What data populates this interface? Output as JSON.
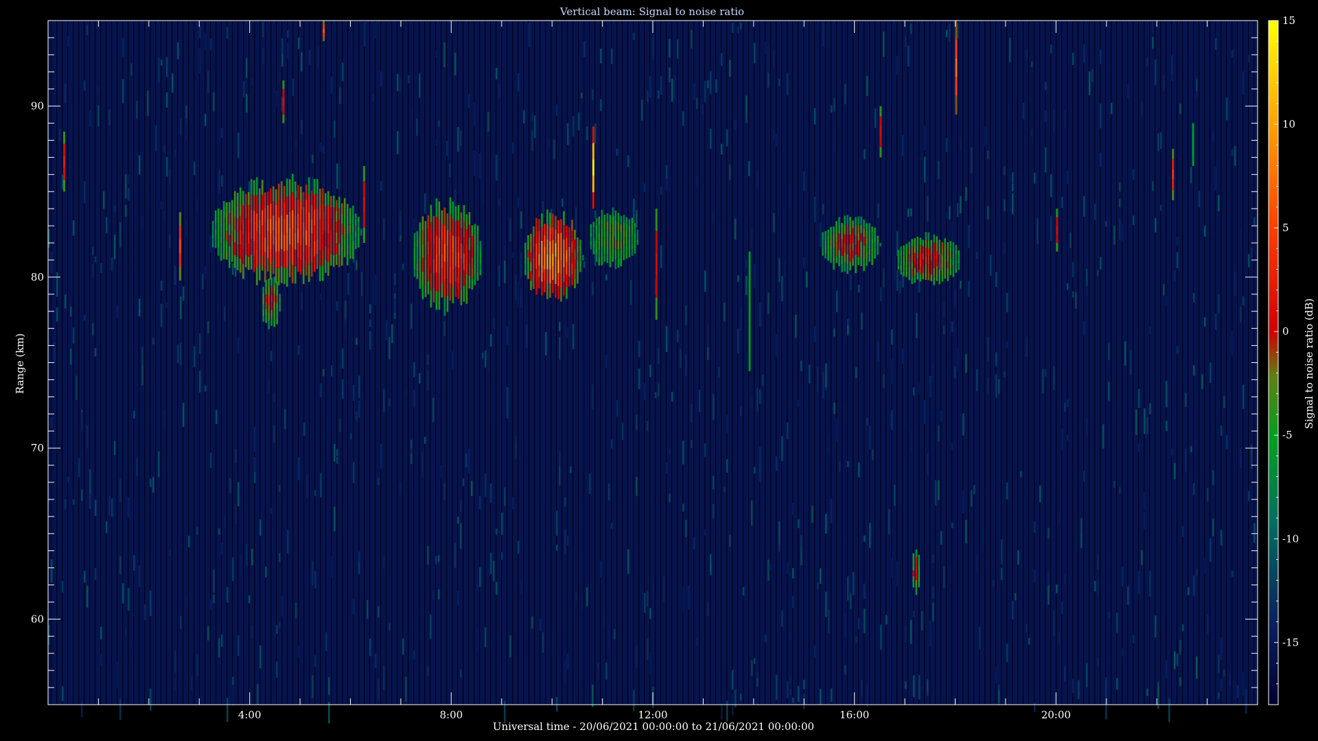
{
  "chart_data": {
    "type": "heatmap",
    "title": "Vertical beam: Signal to noise ratio",
    "xlabel": "Universal time - 20/06/2021 00:00:00 to 21/06/2021 00:00:00",
    "ylabel": "Range (km)",
    "colorbar_label": "Signal to noise ratio (dB)",
    "x_range_hours": [
      0,
      24
    ],
    "y_range_km": [
      55,
      95
    ],
    "x_ticks": [
      {
        "hour": 4,
        "label": "4:00"
      },
      {
        "hour": 8,
        "label": "8:00"
      },
      {
        "hour": 12,
        "label": "12:00"
      },
      {
        "hour": 16,
        "label": "16:00"
      },
      {
        "hour": 20,
        "label": "20:00"
      }
    ],
    "y_ticks": [
      {
        "km": 60,
        "label": "60"
      },
      {
        "km": 70,
        "label": "70"
      },
      {
        "km": 80,
        "label": "80"
      },
      {
        "km": 90,
        "label": "90"
      }
    ],
    "colorbar_range_db": [
      -18,
      15
    ],
    "colorbar_ticks": [
      {
        "db": 15,
        "label": "15"
      },
      {
        "db": 10,
        "label": "10"
      },
      {
        "db": 5,
        "label": "5"
      },
      {
        "db": 0,
        "label": "0"
      },
      {
        "db": -5,
        "label": "-5"
      },
      {
        "db": -10,
        "label": "-10"
      },
      {
        "db": -15,
        "label": "-15"
      }
    ],
    "colormap": [
      {
        "db": -18,
        "color": "#000030"
      },
      {
        "db": -14,
        "color": "#0a2060"
      },
      {
        "db": -9,
        "color": "#007060"
      },
      {
        "db": -5,
        "color": "#00a020"
      },
      {
        "db": -2,
        "color": "#608010"
      },
      {
        "db": 0,
        "color": "#d00000"
      },
      {
        "db": 5,
        "color": "#ff4000"
      },
      {
        "db": 9,
        "color": "#ff9000"
      },
      {
        "db": 15,
        "color": "#ffff00"
      }
    ],
    "echo_regions": [
      {
        "t0": 3.2,
        "t1": 6.2,
        "r0": 79.5,
        "r1": 85.8,
        "peak_db": 6
      },
      {
        "t0": 4.2,
        "t1": 4.6,
        "r0": 77.0,
        "r1": 80.0,
        "peak_db": 1
      },
      {
        "t0": 7.2,
        "t1": 8.6,
        "r0": 78.0,
        "r1": 84.5,
        "peak_db": 5
      },
      {
        "t0": 9.4,
        "t1": 10.6,
        "r0": 78.5,
        "r1": 83.8,
        "peak_db": 9
      },
      {
        "t0": 10.7,
        "t1": 11.7,
        "r0": 80.5,
        "r1": 84.0,
        "peak_db": -3
      },
      {
        "t0": 15.3,
        "t1": 16.5,
        "r0": 80.3,
        "r1": 83.5,
        "peak_db": 0
      },
      {
        "t0": 16.8,
        "t1": 18.1,
        "r0": 79.5,
        "r1": 82.5,
        "peak_db": 1
      },
      {
        "t0": 17.1,
        "t1": 17.3,
        "r0": 61.5,
        "r1": 64.0,
        "peak_db": 0
      }
    ],
    "spikes": [
      {
        "t": 0.3,
        "r0": 85.0,
        "r1": 88.5,
        "peak_db": 2
      },
      {
        "t": 2.6,
        "r0": 79.8,
        "r1": 83.8,
        "peak_db": 5
      },
      {
        "t": 4.65,
        "r0": 89.0,
        "r1": 91.5,
        "peak_db": 1
      },
      {
        "t": 5.45,
        "r0": 93.8,
        "r1": 95.0,
        "peak_db": 6
      },
      {
        "t": 6.25,
        "r0": 82.0,
        "r1": 86.5,
        "peak_db": 1
      },
      {
        "t": 10.8,
        "r0": 84.0,
        "r1": 88.8,
        "peak_db": 14
      },
      {
        "t": 12.05,
        "r0": 77.5,
        "r1": 84.0,
        "peak_db": 1
      },
      {
        "t": 13.9,
        "r0": 74.5,
        "r1": 81.5,
        "peak_db": -5
      },
      {
        "t": 16.5,
        "r0": 87.0,
        "r1": 90.0,
        "peak_db": 1
      },
      {
        "t": 18.0,
        "r0": 89.5,
        "r1": 95.0,
        "peak_db": 7
      },
      {
        "t": 20.0,
        "r0": 81.5,
        "r1": 84.0,
        "peak_db": 1
      },
      {
        "t": 22.3,
        "r0": 84.5,
        "r1": 87.5,
        "peak_db": 4
      },
      {
        "t": 22.7,
        "r0": 86.5,
        "r1": 89.0,
        "peak_db": -5
      }
    ]
  }
}
